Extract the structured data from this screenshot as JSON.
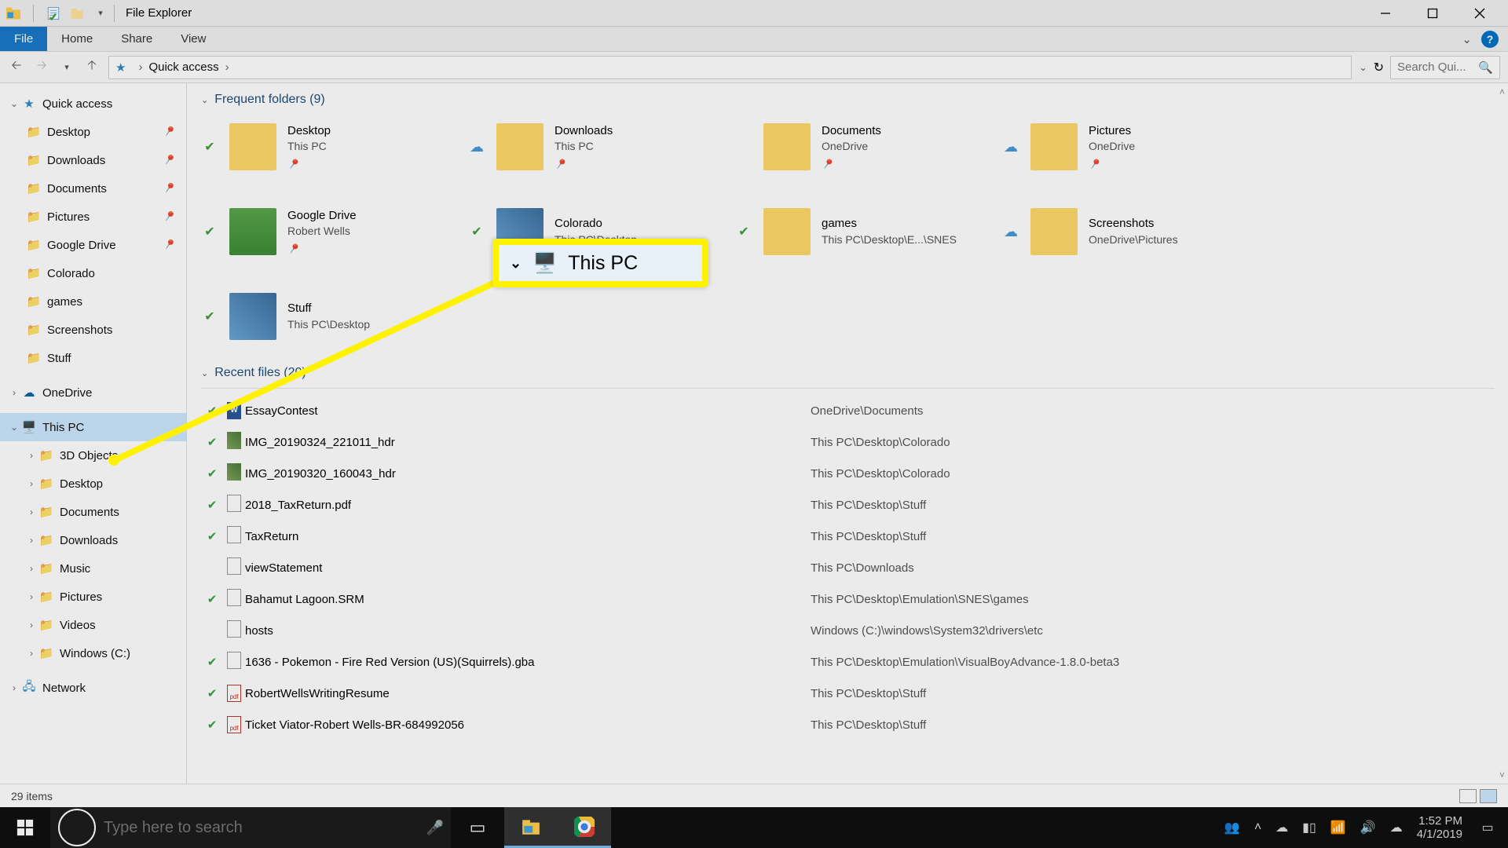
{
  "window": {
    "title": "File Explorer"
  },
  "ribbon": {
    "tabs": {
      "file": "File",
      "home": "Home",
      "share": "Share",
      "view": "View"
    }
  },
  "address": {
    "location": "Quick access",
    "search_placeholder": "Search Qui..."
  },
  "sidebar": {
    "quick_access": "Quick access",
    "pinned": [
      {
        "label": "Desktop"
      },
      {
        "label": "Downloads"
      },
      {
        "label": "Documents"
      },
      {
        "label": "Pictures"
      },
      {
        "label": "Google Drive"
      }
    ],
    "recent_side": [
      {
        "label": "Colorado"
      },
      {
        "label": "games"
      },
      {
        "label": "Screenshots"
      },
      {
        "label": "Stuff"
      }
    ],
    "onedrive": "OneDrive",
    "this_pc": "This PC",
    "this_pc_children": [
      "3D Objects",
      "Desktop",
      "Documents",
      "Downloads",
      "Music",
      "Pictures",
      "Videos",
      "Windows (C:)"
    ],
    "network": "Network"
  },
  "sections": {
    "frequent": "Frequent folders (9)",
    "recent": "Recent files (20)"
  },
  "folders": [
    {
      "name": "Desktop",
      "sub": "This PC",
      "sync": true,
      "pin": true
    },
    {
      "name": "Downloads",
      "sub": "This PC",
      "cloud": true,
      "pin": true
    },
    {
      "name": "Documents",
      "sub": "OneDrive",
      "pin": true
    },
    {
      "name": "Pictures",
      "sub": "OneDrive",
      "cloud": true,
      "pin": true
    },
    {
      "name": "Google Drive",
      "sub": "Robert Wells",
      "sync": true,
      "pin": true,
      "drive": true
    },
    {
      "name": "Colorado",
      "sub": "This PC\\Desktop",
      "sync": true,
      "img": true
    },
    {
      "name": "games",
      "sub": "This PC\\Desktop\\E...\\SNES",
      "sync": true
    },
    {
      "name": "Screenshots",
      "sub": "OneDrive\\Pictures",
      "cloud": true
    },
    {
      "name": "Stuff",
      "sub": "This PC\\Desktop",
      "sync": true,
      "img": true
    }
  ],
  "files": [
    {
      "name": "EssayContest",
      "path": "OneDrive\\Documents",
      "sync": true,
      "icon": "word"
    },
    {
      "name": "IMG_20190324_221011_hdr",
      "path": "This PC\\Desktop\\Colorado",
      "sync": true,
      "icon": "img"
    },
    {
      "name": "IMG_20190320_160043_hdr",
      "path": "This PC\\Desktop\\Colorado",
      "sync": true,
      "icon": "img"
    },
    {
      "name": "2018_TaxReturn.pdf",
      "path": "This PC\\Desktop\\Stuff",
      "sync": true,
      "icon": "doc"
    },
    {
      "name": "TaxReturn",
      "path": "This PC\\Desktop\\Stuff",
      "sync": true,
      "icon": "doc"
    },
    {
      "name": "viewStatement",
      "path": "This PC\\Downloads",
      "icon": "doc"
    },
    {
      "name": "Bahamut Lagoon.SRM",
      "path": "This PC\\Desktop\\Emulation\\SNES\\games",
      "sync": true,
      "icon": "doc"
    },
    {
      "name": "hosts",
      "path": "Windows (C:)\\windows\\System32\\drivers\\etc",
      "icon": "doc"
    },
    {
      "name": "1636 - Pokemon - Fire Red Version (US)(Squirrels).gba",
      "path": "This PC\\Desktop\\Emulation\\VisualBoyAdvance-1.8.0-beta3",
      "sync": true,
      "icon": "doc"
    },
    {
      "name": "RobertWellsWritingResume",
      "path": "This PC\\Desktop\\Stuff",
      "sync": true,
      "icon": "pdf"
    },
    {
      "name": "Ticket Viator-Robert Wells-BR-684992056",
      "path": "This PC\\Desktop\\Stuff",
      "sync": true,
      "icon": "pdf"
    }
  ],
  "callout": {
    "label": "This PC"
  },
  "status": {
    "items": "29 items"
  },
  "taskbar": {
    "search_placeholder": "Type here to search",
    "time": "1:52 PM",
    "date": "4/1/2019"
  }
}
